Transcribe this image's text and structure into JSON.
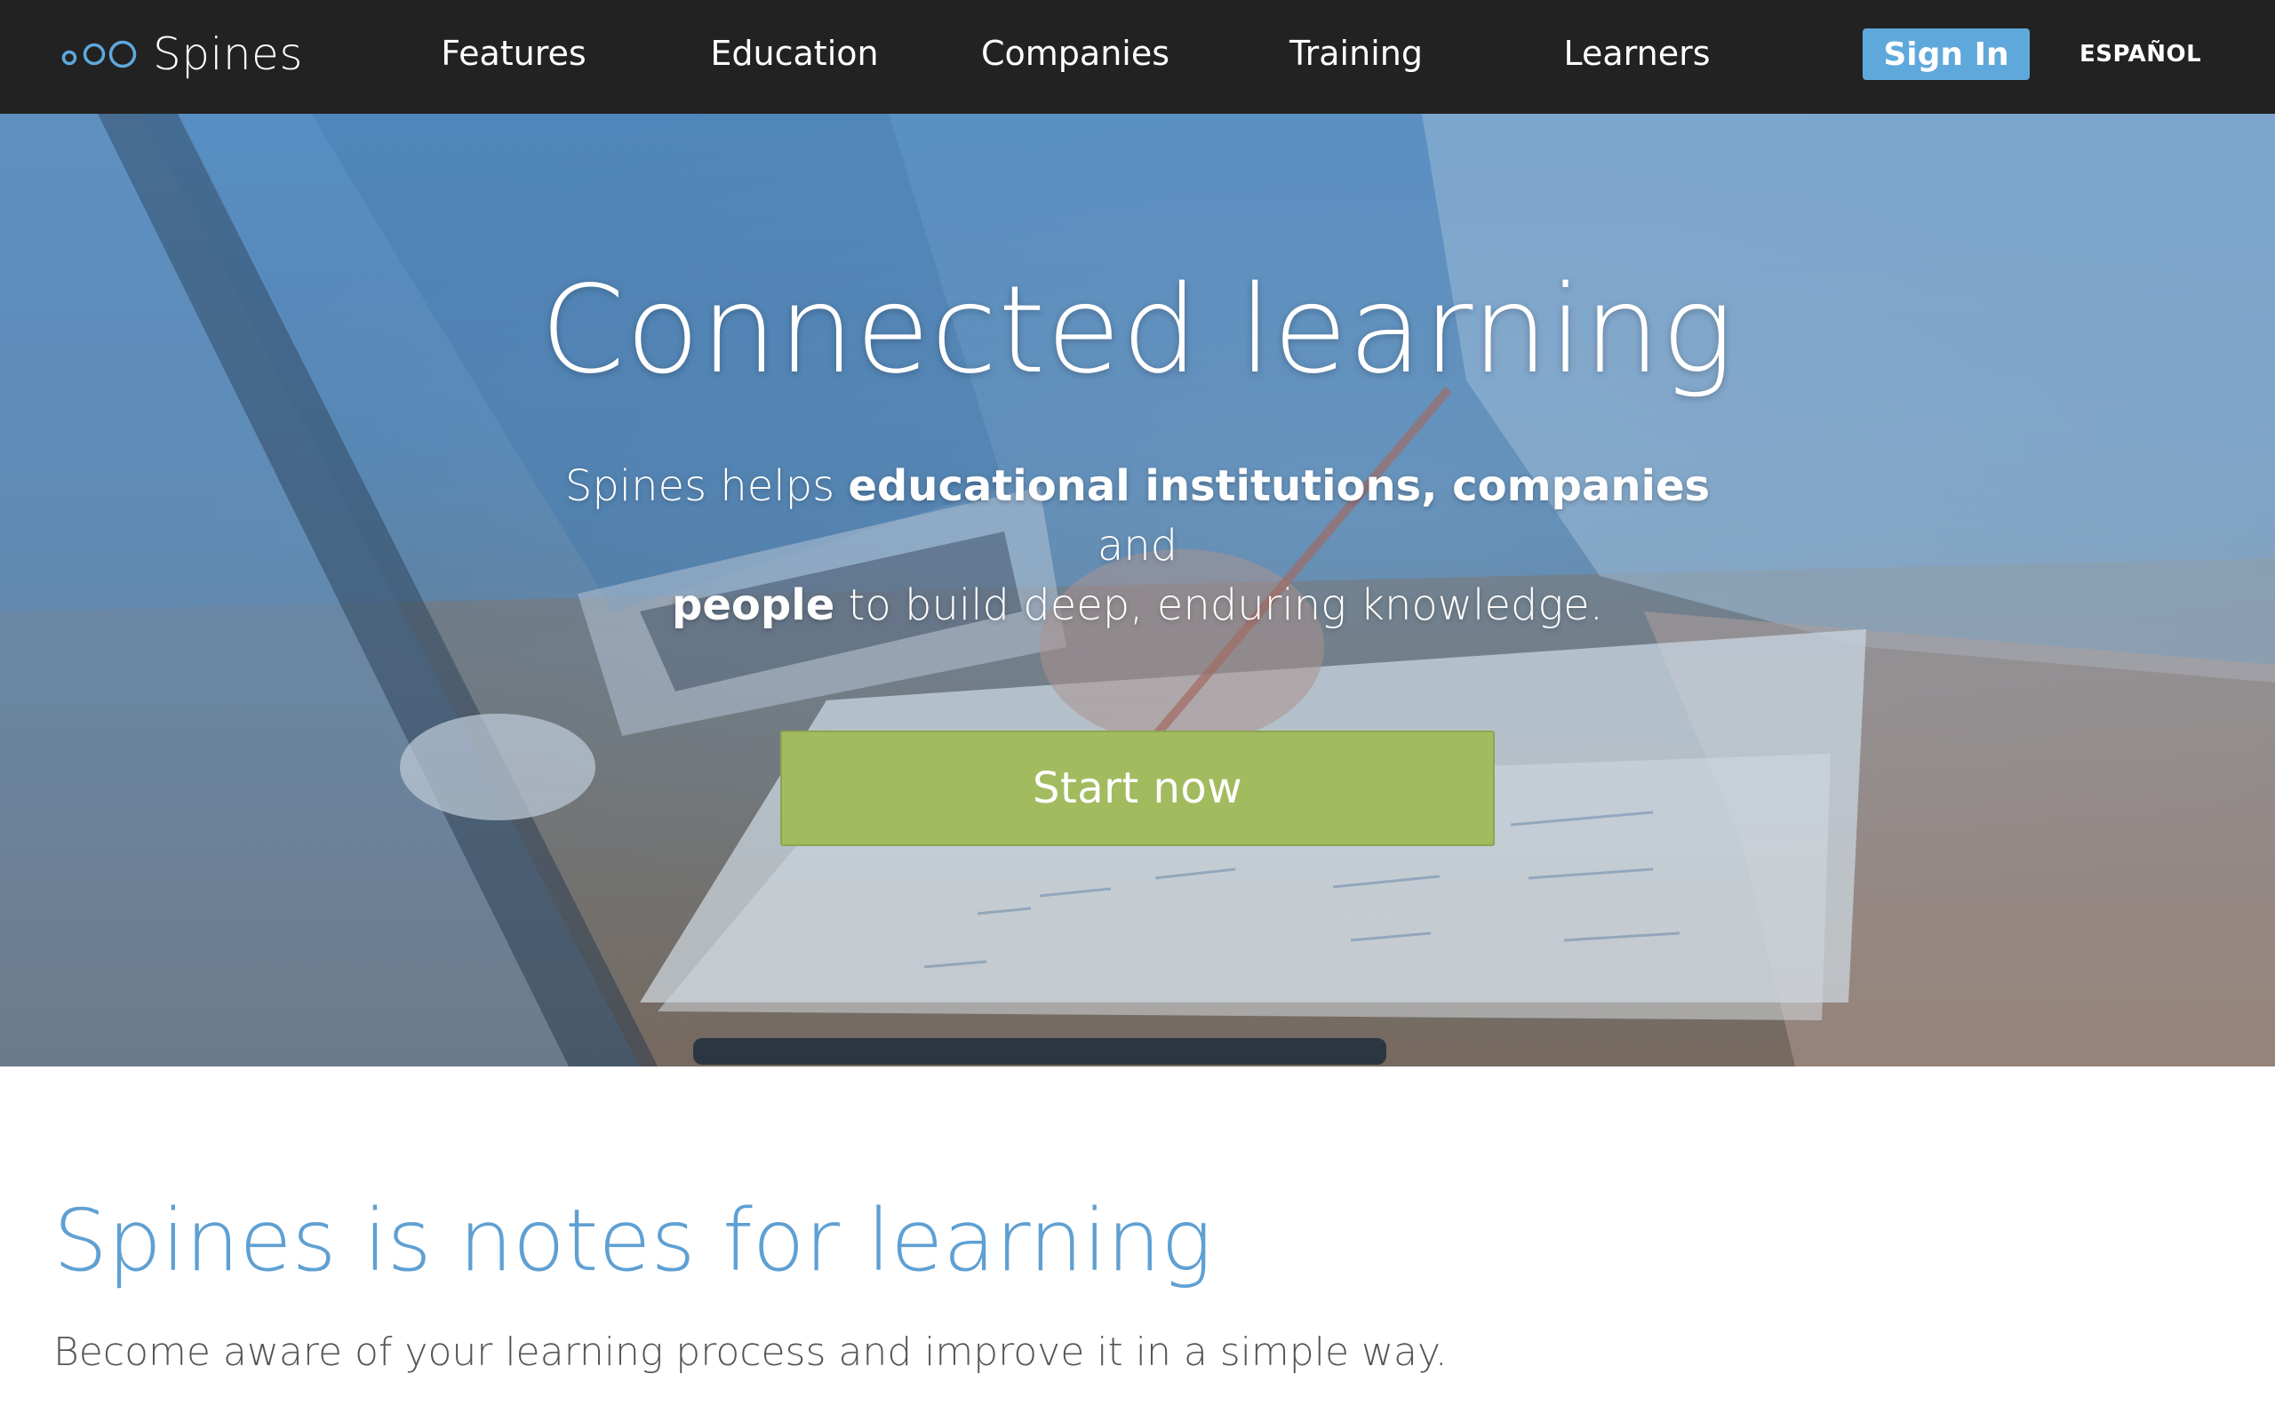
{
  "brand": {
    "name": "Spines",
    "logo_icon": "three-circles-logo",
    "logo_color": "#5fa8dc"
  },
  "nav": {
    "items": [
      {
        "label": "Features"
      },
      {
        "label": "Education"
      },
      {
        "label": "Companies"
      },
      {
        "label": "Training"
      },
      {
        "label": "Learners"
      }
    ],
    "signin_label": "Sign In",
    "language_label": "ESPAÑOL"
  },
  "hero": {
    "title": "Connected learning",
    "subtitle": {
      "part1": "Spines helps ",
      "bold1": "educational institutions, companies",
      "part2": " and ",
      "bold2": "people",
      "part3": " to build deep, enduring knowledge."
    },
    "cta_label": "Start now"
  },
  "intro": {
    "title": "Spines is notes for learning",
    "text": "Become aware of your learning process and improve it in a simple way."
  },
  "colors": {
    "navbar_bg": "#222222",
    "accent_blue": "#5fa8dc",
    "cta_green": "#a3bb5f",
    "heading_blue": "#5fa0d3"
  }
}
